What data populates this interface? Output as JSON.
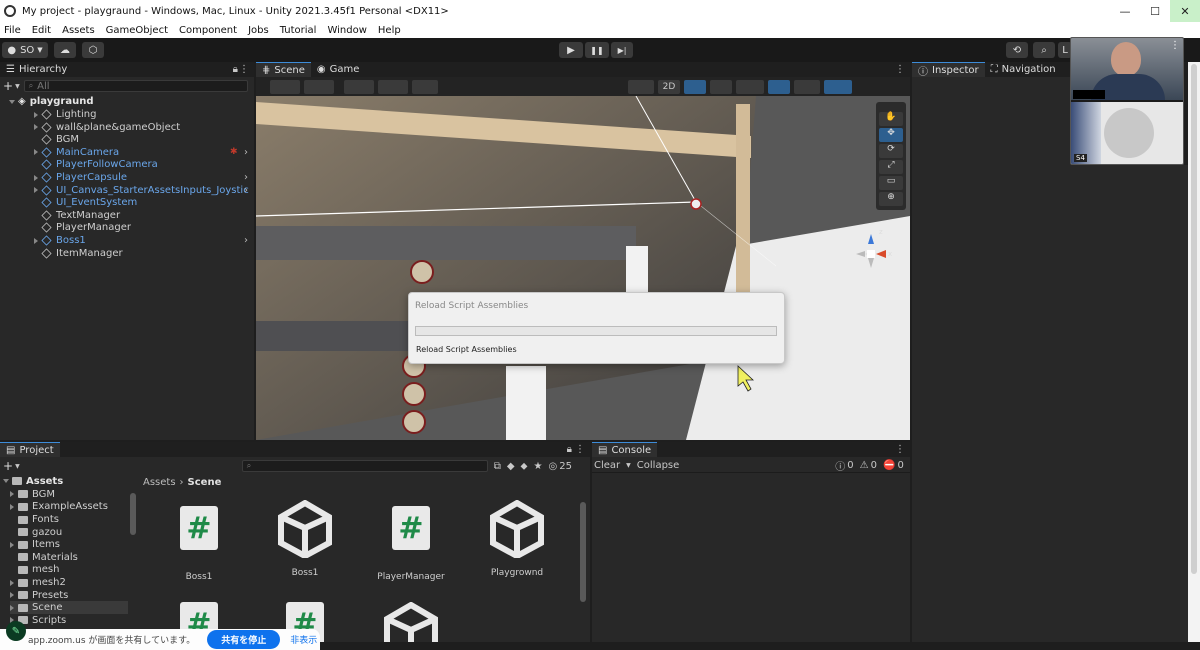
{
  "window": {
    "title": "My project - playgraund - Windows, Mac, Linux - Unity 2021.3.45f1 Personal <DX11>",
    "controls": {
      "minimize": "—",
      "maximize": "☐",
      "close": "✕"
    }
  },
  "menu": [
    "File",
    "Edit",
    "Assets",
    "GameObject",
    "Component",
    "Jobs",
    "Tutorial",
    "Window",
    "Help"
  ],
  "toolbar": {
    "account": "SO",
    "play": "▶",
    "pause": "❚❚",
    "step": "▶|",
    "layout": "L"
  },
  "hierarchy": {
    "tab": "Hierarchy",
    "search_placeholder": "All",
    "scene": "playgraund",
    "items": [
      {
        "label": "Lighting",
        "blue": false,
        "expand": true
      },
      {
        "label": "wall&plane&gameObject",
        "blue": false,
        "expand": true
      },
      {
        "label": "BGM",
        "blue": false,
        "expand": false
      },
      {
        "label": "MainCamera",
        "blue": true,
        "expand": true
      },
      {
        "label": "PlayerFollowCamera",
        "blue": true,
        "expand": false
      },
      {
        "label": "PlayerCapsule",
        "blue": true,
        "expand": true
      },
      {
        "label": "UI_Canvas_StarterAssetsInputs_Joystic",
        "blue": true,
        "expand": true
      },
      {
        "label": "UI_EventSystem",
        "blue": true,
        "expand": false
      },
      {
        "label": "TextManager",
        "blue": false,
        "expand": false
      },
      {
        "label": "PlayerManager",
        "blue": false,
        "expand": false
      },
      {
        "label": "Boss1",
        "blue": true,
        "expand": true
      },
      {
        "label": "ItemManager",
        "blue": false,
        "expand": false
      }
    ]
  },
  "scene_tabs": {
    "scene": "Scene",
    "game": "Game",
    "mode_2d": "2D"
  },
  "right_tabs": {
    "inspector": "Inspector",
    "navigation": "Navigation"
  },
  "dialog": {
    "title": "Reload Script Assemblies",
    "message": "Reload Script Assemblies",
    "progress": 0.0
  },
  "gizmo": {
    "x": "x",
    "z": "z"
  },
  "project": {
    "tab": "Project",
    "count": "25",
    "breadcrumb": [
      "Assets",
      "Scene"
    ],
    "root": "Assets",
    "folders": [
      "BGM",
      "ExampleAssets",
      "Fonts",
      "gazou",
      "Items",
      "Materials",
      "mesh",
      "mesh2",
      "Presets",
      "Scene",
      "Scripts"
    ],
    "assets": [
      {
        "name": "Boss1",
        "kind": "script"
      },
      {
        "name": "Boss1",
        "kind": "unity"
      },
      {
        "name": "PlayerManager",
        "kind": "script"
      },
      {
        "name": "Playgrownd",
        "kind": "unity"
      }
    ]
  },
  "console": {
    "tab": "Console",
    "clear": "Clear",
    "collapse": "Collapse",
    "errors": "0",
    "warnings": "0",
    "logs": "0"
  },
  "zoom": {
    "notice": "app.zoom.us が画面を共有しています。",
    "stop": "共有を停止",
    "hide": "非表示"
  },
  "video": {
    "tile_label": "S4"
  }
}
